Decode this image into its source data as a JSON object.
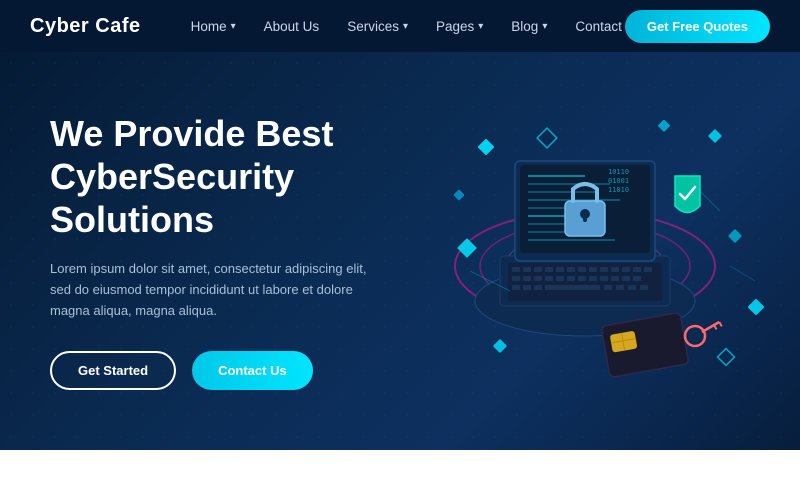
{
  "brand": {
    "name": "Cyber Cafe"
  },
  "nav": {
    "links": [
      {
        "label": "Home",
        "has_dropdown": true
      },
      {
        "label": "About Us",
        "has_dropdown": false
      },
      {
        "label": "Services",
        "has_dropdown": true
      },
      {
        "label": "Pages",
        "has_dropdown": true
      },
      {
        "label": "Blog",
        "has_dropdown": true
      },
      {
        "label": "Contact",
        "has_dropdown": false
      }
    ],
    "cta_label": "Get Free Quotes"
  },
  "hero": {
    "title_line1": "We Provide Best",
    "title_line2": "CyberSecurity Solutions",
    "description": "Lorem ipsum dolor sit amet, consectetur adipiscing elit, sed do eiusmod tempor incididunt ut labore et dolore magna aliqua, magna aliqua.",
    "btn_get_started": "Get Started",
    "btn_contact": "Contact Us"
  }
}
